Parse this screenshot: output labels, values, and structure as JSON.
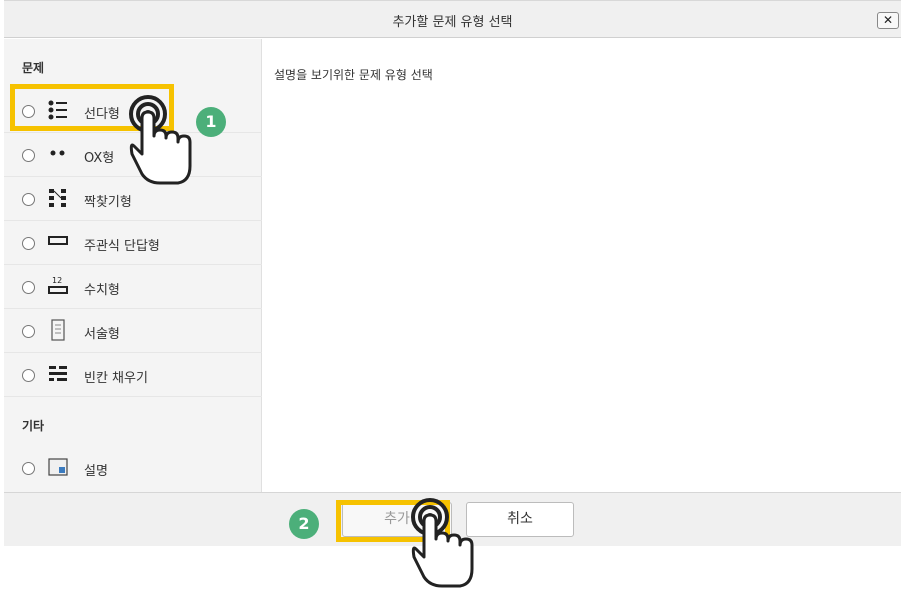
{
  "dialog": {
    "title": "추가할 문제 유형 선택",
    "close_label": "✕"
  },
  "sidebar": {
    "section_questions": "문제",
    "section_other": "기타",
    "question_types": [
      {
        "label": "선다형",
        "icon": "multiple-choice-icon"
      },
      {
        "label": "OX형",
        "icon": "true-false-icon"
      },
      {
        "label": "짝찾기형",
        "icon": "matching-icon"
      },
      {
        "label": "주관식 단답형",
        "icon": "short-answer-icon"
      },
      {
        "label": "수치형",
        "icon": "numerical-icon"
      },
      {
        "label": "서술형",
        "icon": "essay-icon"
      },
      {
        "label": "빈칸 채우기",
        "icon": "fill-blank-icon"
      }
    ],
    "other_types": [
      {
        "label": "설명",
        "icon": "description-icon"
      }
    ]
  },
  "main": {
    "description": "설명을 보기위한 문제 유형 선택"
  },
  "footer": {
    "add_label": "추가",
    "cancel_label": "취소"
  },
  "annotations": {
    "step1": "1",
    "step2": "2",
    "highlight_color": "#f6c200",
    "badge_color": "#4caf7a"
  }
}
